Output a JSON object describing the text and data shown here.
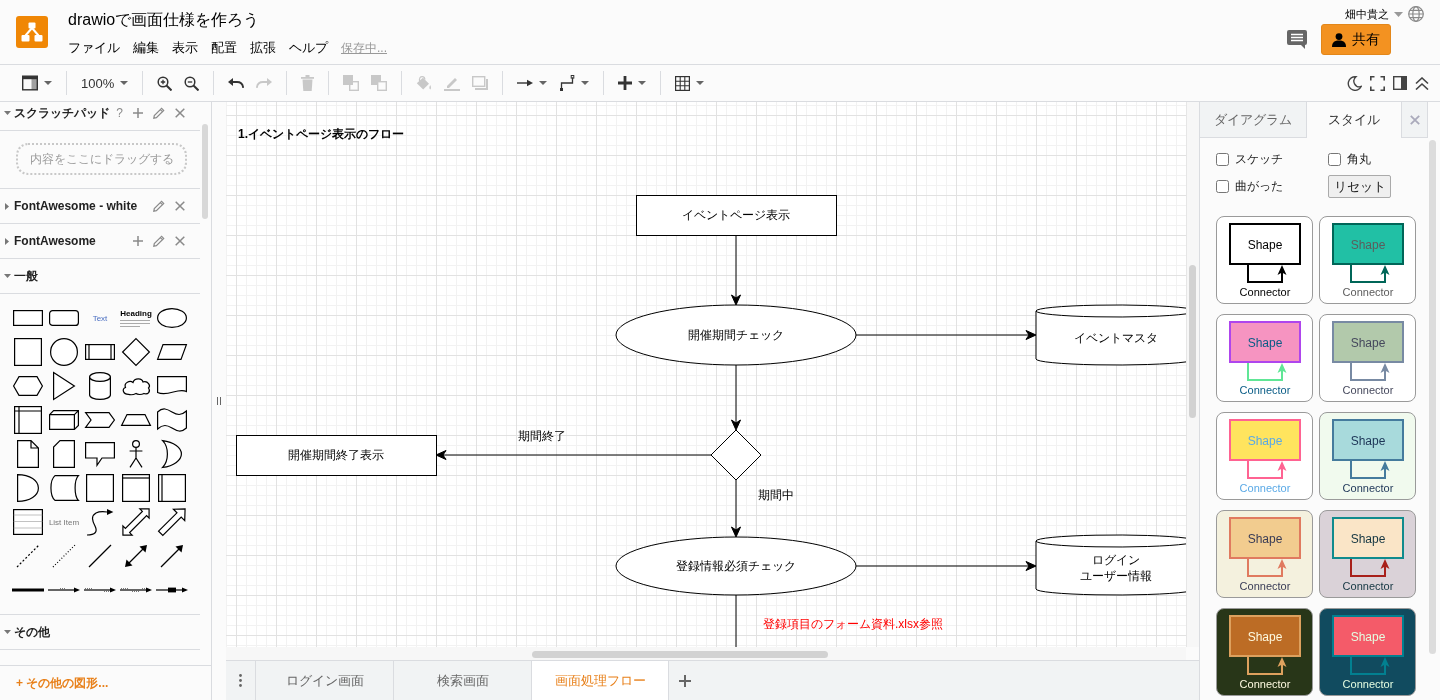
{
  "header": {
    "title": "drawioで画面仕様を作ろう",
    "menu": [
      "ファイル",
      "編集",
      "表示",
      "配置",
      "拡張",
      "ヘルプ"
    ],
    "status": "保存中...",
    "user": "畑中貴之",
    "share": "共有"
  },
  "toolbar": {
    "groups": [
      [
        {
          "kind": "format",
          "disabled": false
        }
      ],
      [
        {
          "kind": "zoom",
          "label": "100%",
          "disabled": false
        }
      ],
      [
        {
          "kind": "zoom_in",
          "disabled": false
        },
        {
          "kind": "zoom_out",
          "disabled": false
        }
      ],
      [
        {
          "kind": "undo",
          "disabled": false
        },
        {
          "kind": "redo",
          "disabled": true
        }
      ],
      [
        {
          "kind": "delete",
          "disabled": true
        }
      ],
      [
        {
          "kind": "to_front",
          "disabled": true
        },
        {
          "kind": "to_back",
          "disabled": true
        }
      ],
      [
        {
          "kind": "fill",
          "disabled": true
        },
        {
          "kind": "line",
          "disabled": true
        },
        {
          "kind": "shadow",
          "disabled": true
        }
      ],
      [
        {
          "kind": "connection",
          "disabled": false
        },
        {
          "kind": "waypoints",
          "disabled": false
        }
      ],
      [
        {
          "kind": "insert",
          "disabled": false
        }
      ],
      [
        {
          "kind": "table",
          "disabled": false
        }
      ]
    ],
    "view": [
      {
        "kind": "theme"
      },
      {
        "kind": "fullscreen"
      },
      {
        "kind": "panel"
      },
      {
        "kind": "collapse"
      }
    ]
  },
  "sidebar": {
    "sections": [
      {
        "title": "スクラッチパッド",
        "expanded": true,
        "help": "?",
        "tools": [
          {
            "kind": "add"
          },
          {
            "kind": "edit"
          },
          {
            "kind": "close"
          }
        ],
        "drop_hint": "内容をここにドラッグする"
      },
      {
        "title": "FontAwesome - white",
        "expanded": false,
        "tools": [
          {
            "kind": "edit"
          },
          {
            "kind": "close"
          }
        ]
      },
      {
        "title": "FontAwesome",
        "expanded": false,
        "tools": [
          {
            "kind": "add"
          },
          {
            "kind": "edit"
          },
          {
            "kind": "close"
          }
        ]
      },
      {
        "title": "一般",
        "expanded": true,
        "shapes": [
          {
            "kind": "rect"
          },
          {
            "kind": "rounded"
          },
          {
            "kind": "text",
            "label": "Text"
          },
          {
            "kind": "heading",
            "label": "Heading"
          },
          {
            "kind": "ellipse"
          },
          {
            "kind": "square"
          },
          {
            "kind": "circle"
          },
          {
            "kind": "process"
          },
          {
            "kind": "diamond"
          },
          {
            "kind": "parallelogram"
          },
          {
            "kind": "hexagon"
          },
          {
            "kind": "triangle"
          },
          {
            "kind": "cylinder"
          },
          {
            "kind": "cloud"
          },
          {
            "kind": "document"
          },
          {
            "kind": "internal_storage"
          },
          {
            "kind": "cube"
          },
          {
            "kind": "step"
          },
          {
            "kind": "trapezoid"
          },
          {
            "kind": "tape"
          },
          {
            "kind": "note"
          },
          {
            "kind": "card"
          },
          {
            "kind": "callout"
          },
          {
            "kind": "actor"
          },
          {
            "kind": "or"
          },
          {
            "kind": "d_shape"
          },
          {
            "kind": "data_storage"
          },
          {
            "kind": "container"
          },
          {
            "kind": "header_container"
          },
          {
            "kind": "swimlane"
          },
          {
            "kind": "list"
          },
          {
            "kind": "list_item",
            "label": "List Item"
          },
          {
            "kind": "curve"
          },
          {
            "kind": "double_arrow"
          },
          {
            "kind": "block_arrow"
          },
          {
            "kind": "dashed_line"
          },
          {
            "kind": "dotted_line"
          },
          {
            "kind": "line"
          },
          {
            "kind": "double_line"
          },
          {
            "kind": "arrow_line"
          },
          {
            "kind": "thick_line"
          },
          {
            "kind": "connector_label"
          },
          {
            "kind": "connector_2labels"
          },
          {
            "kind": "connector_3labels"
          },
          {
            "kind": "connector_symbol"
          }
        ]
      },
      {
        "title": "その他",
        "expanded": true
      }
    ],
    "more_shapes": "+ その他の図形..."
  },
  "canvas": {
    "title": "1.イベントページ表示のフロー",
    "nodes": [
      {
        "kind": "process",
        "label": "イベントページ表示"
      },
      {
        "kind": "ellipse",
        "label": "開催期間チェック"
      },
      {
        "kind": "database",
        "lines": [
          "イベントマスタ"
        ]
      },
      {
        "kind": "decision"
      },
      {
        "kind": "process",
        "label": "開催期間終了表示"
      },
      {
        "kind": "ellipse",
        "label": "登録情報必須チェック"
      },
      {
        "kind": "database",
        "lines": [
          "ログイン",
          "ユーザー情報"
        ]
      }
    ],
    "edges": [
      {
        "kind": "arrow"
      },
      {
        "kind": "arrow"
      },
      {
        "kind": "arrow"
      },
      {
        "kind": "arrow",
        "label": "期間終了"
      },
      {
        "kind": "arrow",
        "label": "期間中"
      },
      {
        "kind": "arrow"
      },
      {
        "kind": "line"
      }
    ],
    "note": "登録項目のフォーム資料.xlsx参照"
  },
  "pages": {
    "tabs": [
      {
        "label": "ログイン画面",
        "selected": false
      },
      {
        "label": "検索画面",
        "selected": false
      },
      {
        "label": "画面処理フロー",
        "selected": true
      }
    ]
  },
  "format_panel": {
    "tabs": [
      {
        "label": "ダイアグラム",
        "selected": false
      },
      {
        "label": "スタイル",
        "selected": true
      }
    ],
    "options": [
      {
        "label": "スケッチ",
        "checked": false
      },
      {
        "label": "角丸",
        "checked": false
      },
      {
        "label": "曲がった",
        "checked": false
      }
    ],
    "reset": "リセット",
    "styles": [
      {
        "label": "Shape",
        "caption": "Connector",
        "fill": {
          "color": "#ffffff"
        },
        "stroke": {
          "color": "#000000"
        },
        "font": {
          "color": "#000000"
        },
        "edge": {
          "color": "#000000"
        },
        "background": {
          "color": "#ffffff"
        }
      },
      {
        "label": "Shape",
        "caption": "Connector",
        "fill": {
          "color": "#21c0a5"
        },
        "stroke": {
          "color": "#006658"
        },
        "font": {
          "color": "#5c5c5c"
        },
        "edge": {
          "color": "#006658"
        },
        "background": {
          "color": "#ffffff"
        }
      },
      {
        "label": "Shape",
        "caption": "Connector",
        "fill": {
          "color": "#f694c1"
        },
        "stroke": {
          "color": "#af45ed"
        },
        "font": {
          "color": "#095c86"
        },
        "edge": {
          "color": "#60e696"
        },
        "background": {
          "color": "#ffffff"
        }
      },
      {
        "label": "Shape",
        "caption": "Connector",
        "fill": {
          "color": "#b2c9ab"
        },
        "stroke": {
          "color": "#788aa3"
        },
        "font": {
          "color": "#46495d"
        },
        "edge": {
          "color": "#788aa3"
        },
        "background": {
          "color": "#ffffff"
        }
      },
      {
        "label": "Shape",
        "caption": "Connector",
        "fill": {
          "color": "#ffe45e"
        },
        "stroke": {
          "color": "#ff6392"
        },
        "font": {
          "color": "#5aa9e6"
        },
        "edge": {
          "color": "#ff6392"
        },
        "background": {
          "color": "#ffffff"
        }
      },
      {
        "label": "Shape",
        "caption": "Connector",
        "fill": {
          "color": "#a8dadc"
        },
        "stroke": {
          "color": "#457b9d"
        },
        "font": {
          "color": "#1d3557"
        },
        "edge": {
          "color": "#457b9d"
        },
        "background": {
          "color": "#f1faee"
        }
      },
      {
        "label": "Shape",
        "caption": "Connector",
        "fill": {
          "color": "#f2cc8f"
        },
        "stroke": {
          "color": "#e07a5f"
        },
        "font": {
          "color": "#393c56"
        },
        "edge": {
          "color": "#e07a5f"
        },
        "background": {
          "color": "#f4f1de"
        }
      },
      {
        "label": "Shape",
        "caption": "Connector",
        "fill": {
          "color": "#fae5c7"
        },
        "stroke": {
          "color": "#0f8b8d"
        },
        "font": {
          "color": "#143642"
        },
        "edge": {
          "color": "#a8201a"
        },
        "background": {
          "color": "#dad2d8"
        }
      },
      {
        "label": "Shape",
        "caption": "Connector",
        "fill": {
          "color": "#bc6c25"
        },
        "stroke": {
          "color": "#dda15e"
        },
        "font": {
          "color": "#fefae0"
        },
        "edge": {
          "color": "#dda15e"
        },
        "background": {
          "color": "#283618"
        }
      },
      {
        "label": "Shape",
        "caption": "Connector",
        "fill": {
          "color": "#f45b69"
        },
        "stroke": {
          "color": "#028090"
        },
        "font": {
          "color": "#e4fde1"
        },
        "edge": {
          "color": "#028090"
        },
        "background": {
          "color": "#114b5f"
        }
      }
    ]
  }
}
